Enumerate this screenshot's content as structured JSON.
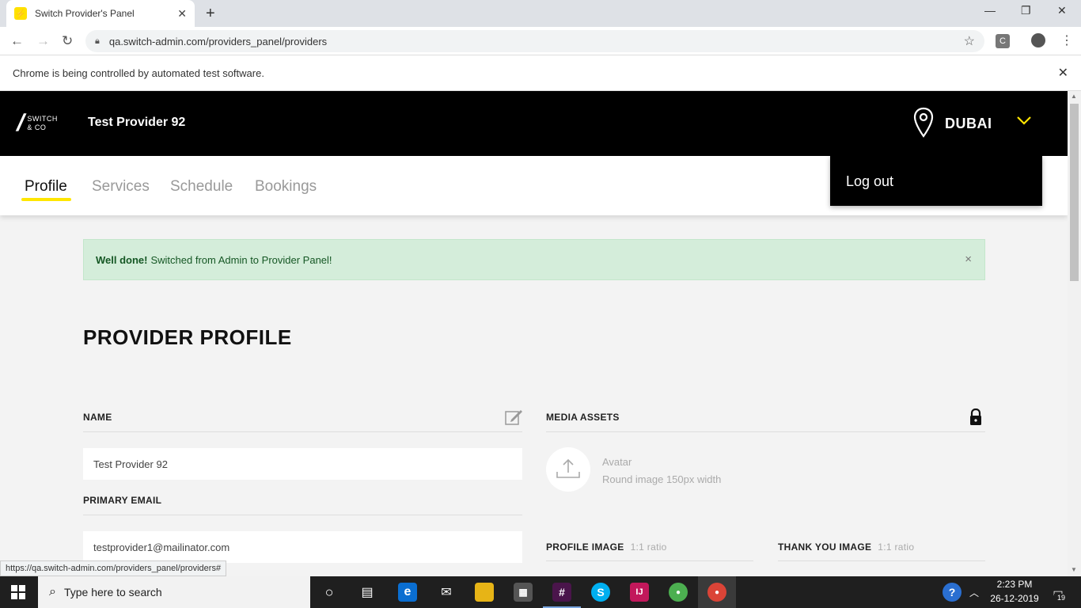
{
  "browser": {
    "tab_title": "Switch Provider's Panel",
    "tab_favicon": "⚡",
    "url": "qa.switch-admin.com/providers_panel/providers",
    "infobar_text": "Chrome is being controlled by automated test software.",
    "status_url": "https://qa.switch-admin.com/providers_panel/providers#"
  },
  "header": {
    "logo_line1": "SWITCH",
    "logo_line2": "& CO",
    "provider_name": "Test Provider 92",
    "city": "DUBAI"
  },
  "nav": {
    "tabs": [
      {
        "label": "Profile",
        "active": true
      },
      {
        "label": "Services"
      },
      {
        "label": "Schedule"
      },
      {
        "label": "Bookings"
      }
    ],
    "dropdown_logout": "Log out"
  },
  "alert": {
    "strong": "Well done!",
    "message": "Switched from Admin to Provider Panel!",
    "close": "×"
  },
  "page": {
    "title": "PROVIDER PROFILE",
    "name_label": "NAME",
    "name_value": "Test Provider 92",
    "email_label": "PRIMARY EMAIL",
    "email_value": "testprovider1@mailinator.com",
    "media_label": "MEDIA ASSETS",
    "avatar_title": "Avatar",
    "avatar_sub": "Round image 150px width",
    "profile_image_label": "PROFILE IMAGE",
    "profile_image_ratio": "1:1 ratio",
    "thankyou_image_label": "THANK YOU IMAGE",
    "thankyou_image_ratio": "1:1 ratio"
  },
  "taskbar": {
    "search_placeholder": "Type here to search",
    "time": "2:23 PM",
    "date": "26-12-2019",
    "notification_count": "19"
  },
  "colors": {
    "accent_yellow": "#ffe600",
    "header_bg": "#000000",
    "alert_bg": "#d4edda"
  }
}
